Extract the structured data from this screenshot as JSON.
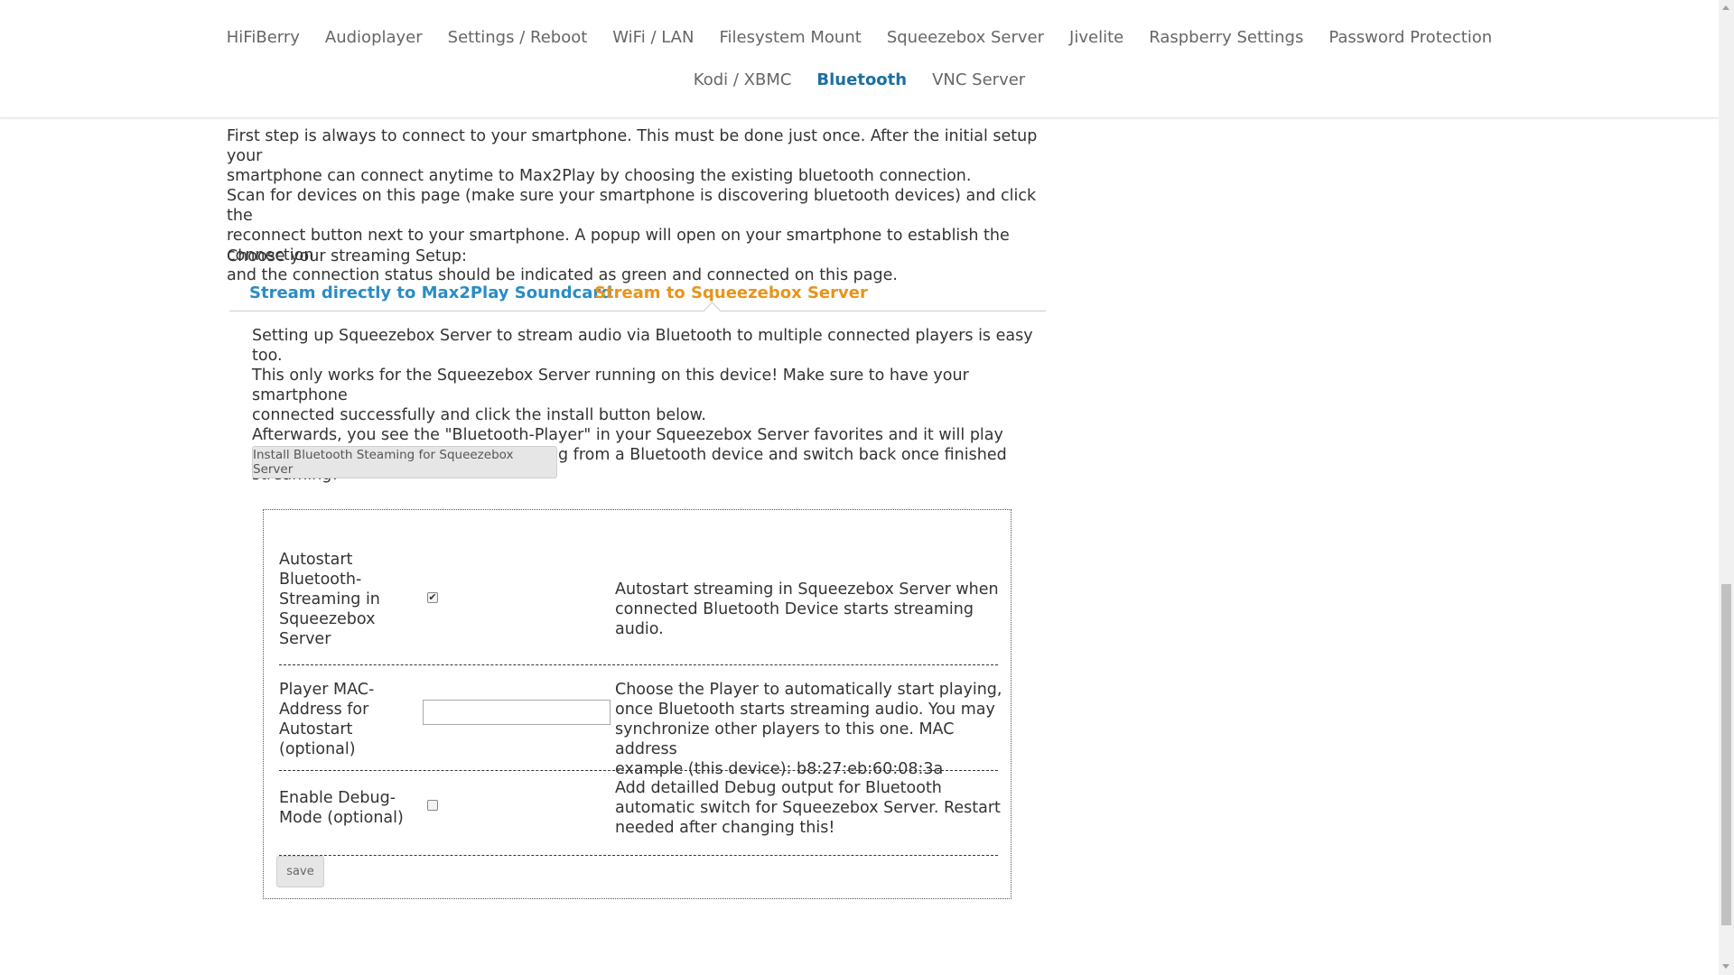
{
  "nav": {
    "row1": [
      "HiFiBerry",
      "Audioplayer",
      "Settings / Reboot",
      "WiFi / LAN",
      "Filesystem Mount",
      "Squeezebox Server",
      "Jivelite",
      "Raspberry Settings",
      "Password Protection"
    ],
    "row2": [
      "Kodi / XBMC",
      "Bluetooth",
      "VNC Server"
    ],
    "active": "Bluetooth"
  },
  "intro": {
    "lines": [
      "First step is always to connect to your smartphone. This must be done just once. After the initial setup your",
      "smartphone can connect anytime to Max2Play by choosing the existing bluetooth connection.",
      "Scan for devices on this page (make sure your smartphone is discovering bluetooth devices) and click the",
      "reconnect button next to your smartphone. A popup will open on your smartphone to establish the connection",
      "and the connection status should be indicated as green and connected on this page."
    ],
    "choose": "Choose your streaming Setup:"
  },
  "tabs": {
    "direct": "Stream directly to Max2Play Soundcard",
    "squeezebox": "Stream to Squeezebox Server"
  },
  "panel": {
    "lines": [
      "Setting up Squeezebox Server to stream audio via Bluetooth to multiple connected players is easy too.",
      "This only works for the Squeezebox Server running on this device! Make sure to have your smartphone",
      "connected successfully and click the install button below.",
      "Afterwards, you see the \"Bluetooth-Player\" in your Squeezebox Server favorites and it will play",
      "automatically when you start streaming from a Bluetooth device and switch back once finished",
      "streaming!"
    ],
    "install_label": "Install Bluetooth Steaming for Squeezebox Server"
  },
  "form": {
    "autostart": {
      "label_lines": [
        "Autostart",
        "Bluetooth-",
        "Streaming in",
        "Squeezebox",
        "Server"
      ],
      "checked": true,
      "check_glyph": "✔",
      "desc_lines": [
        "Autostart streaming in Squeezebox Server when",
        "connected Bluetooth Device starts streaming audio."
      ]
    },
    "mac": {
      "label_lines": [
        "Player MAC-",
        "Address for",
        "Autostart",
        "(optional)"
      ],
      "value": "",
      "desc_lines": [
        "Choose the Player to automatically start playing,",
        "once Bluetooth starts streaming audio. You may",
        "synchronize other players to this one. MAC address",
        "example (this device): b8:27:eb:60:08:3a"
      ]
    },
    "debug": {
      "label_lines": [
        "Enable Debug-",
        "Mode (optional)"
      ],
      "checked": false,
      "desc_lines": [
        "Add detailled Debug output for Bluetooth",
        "automatic switch for Squeezebox Server. Restart",
        "needed after changing this!"
      ]
    },
    "save_label": "save"
  }
}
